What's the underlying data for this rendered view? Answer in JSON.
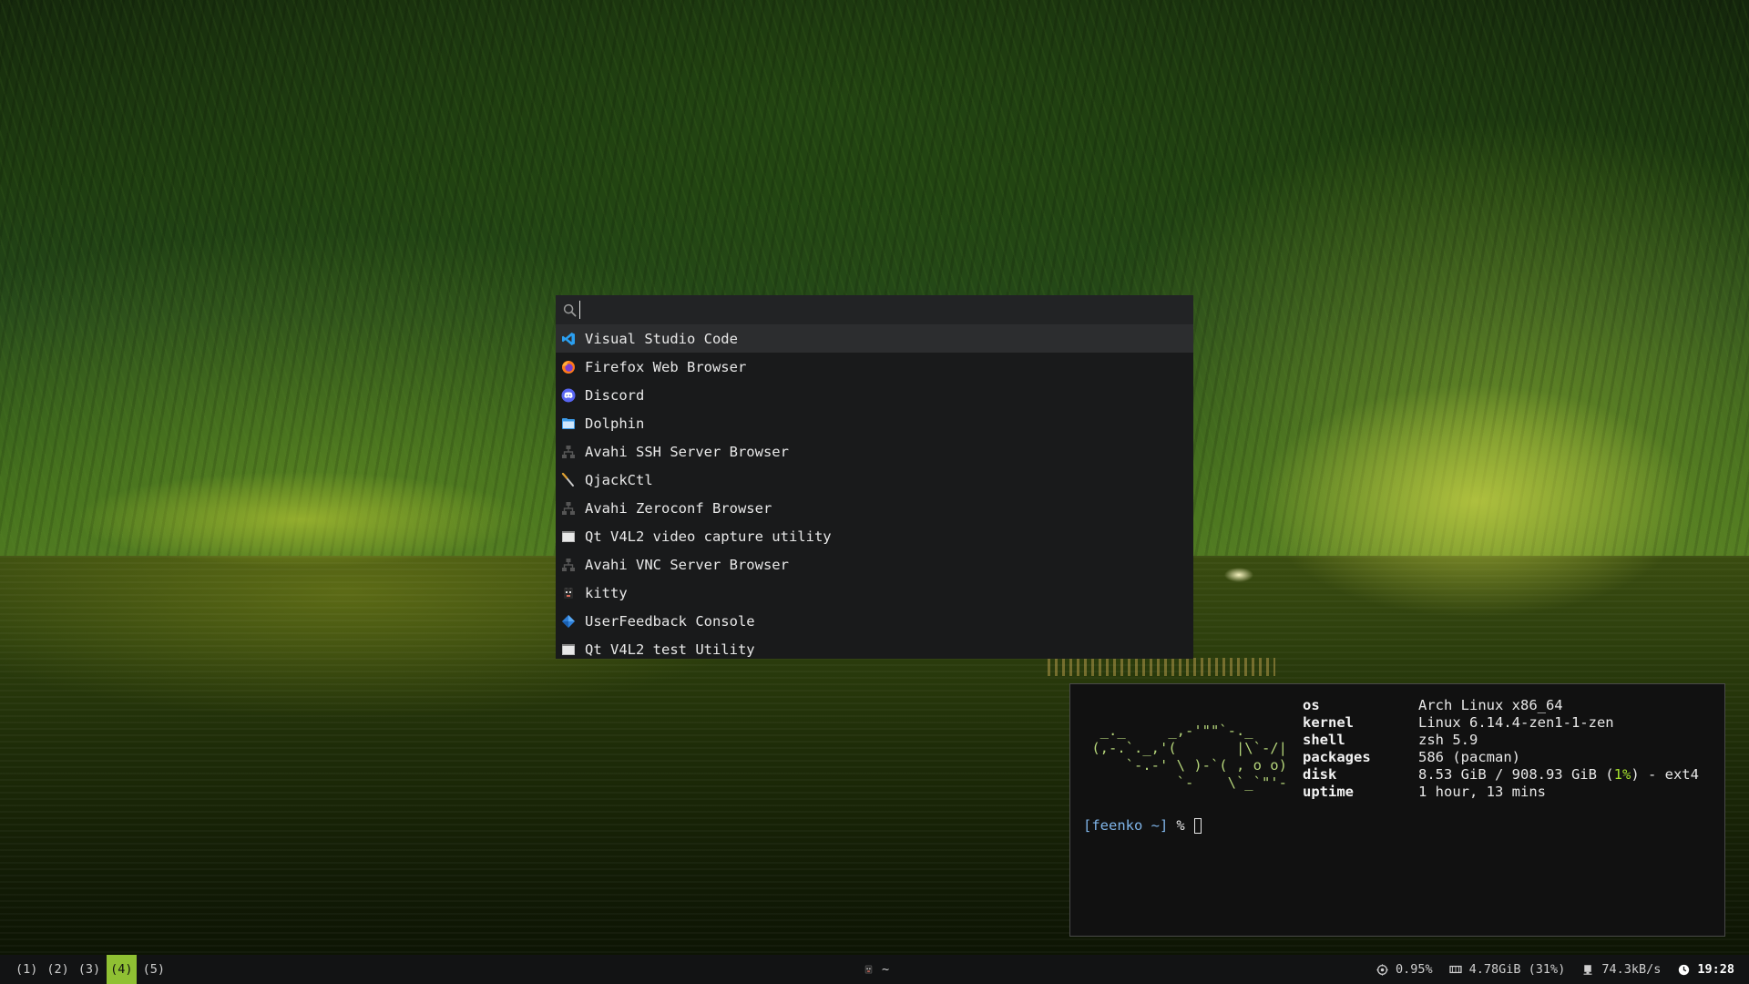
{
  "launcher": {
    "search_value": "",
    "search_placeholder": "",
    "items": [
      {
        "label": "Visual Studio Code",
        "icon": "vscode-icon",
        "selected": true
      },
      {
        "label": "Firefox Web Browser",
        "icon": "firefox-icon"
      },
      {
        "label": "Discord",
        "icon": "discord-icon"
      },
      {
        "label": "Dolphin",
        "icon": "folder-icon"
      },
      {
        "label": "Avahi SSH Server Browser",
        "icon": "network-icon"
      },
      {
        "label": "QjackCtl",
        "icon": "qjackctl-icon"
      },
      {
        "label": "Avahi Zeroconf Browser",
        "icon": "network-icon"
      },
      {
        "label": "Qt V4L2 video capture utility",
        "icon": "video-window-icon"
      },
      {
        "label": "Avahi VNC Server Browser",
        "icon": "network-icon"
      },
      {
        "label": "kitty",
        "icon": "kitty-icon"
      },
      {
        "label": "UserFeedback Console",
        "icon": "userfeedback-icon"
      },
      {
        "label": "Qt V4L2 test Utility",
        "icon": "video-window-icon"
      }
    ]
  },
  "terminal": {
    "logo": [
      "  _._     _,-'\"\"`-._",
      " (,-.`._,'(       |\\`-/|",
      "     `-.-' \\ )-`( , o o)",
      "           `-    \\`_`\"'-"
    ],
    "info": [
      {
        "key": "os",
        "value": "Arch Linux x86_64"
      },
      {
        "key": "kernel",
        "value": "Linux 6.14.4-zen1-1-zen"
      },
      {
        "key": "shell",
        "value": "zsh 5.9"
      },
      {
        "key": "packages",
        "value": "586 (pacman)"
      },
      {
        "key": "disk",
        "value_prefix": "8.53 GiB / 908.93 GiB (",
        "value_highlight": "1%",
        "value_suffix": ") - ext4"
      },
      {
        "key": "uptime",
        "value": "1 hour, 13 mins"
      }
    ],
    "prompt": {
      "open": "[feenko ~]",
      "symbol": "%"
    }
  },
  "statusbar": {
    "workspaces": [
      "(1)",
      "(2)",
      "(3)",
      "(4)",
      "(5)"
    ],
    "active_workspace": "(4)",
    "window_title": "~",
    "cpu": "0.95%",
    "memory": "4.78GiB (31%)",
    "network": "74.3kB/s",
    "clock": "19:28"
  },
  "colors": {
    "accent": "#8fc033",
    "logo": "#b5d57a",
    "prompt": "#7fb4e8",
    "highlight": "#a6e22e"
  }
}
